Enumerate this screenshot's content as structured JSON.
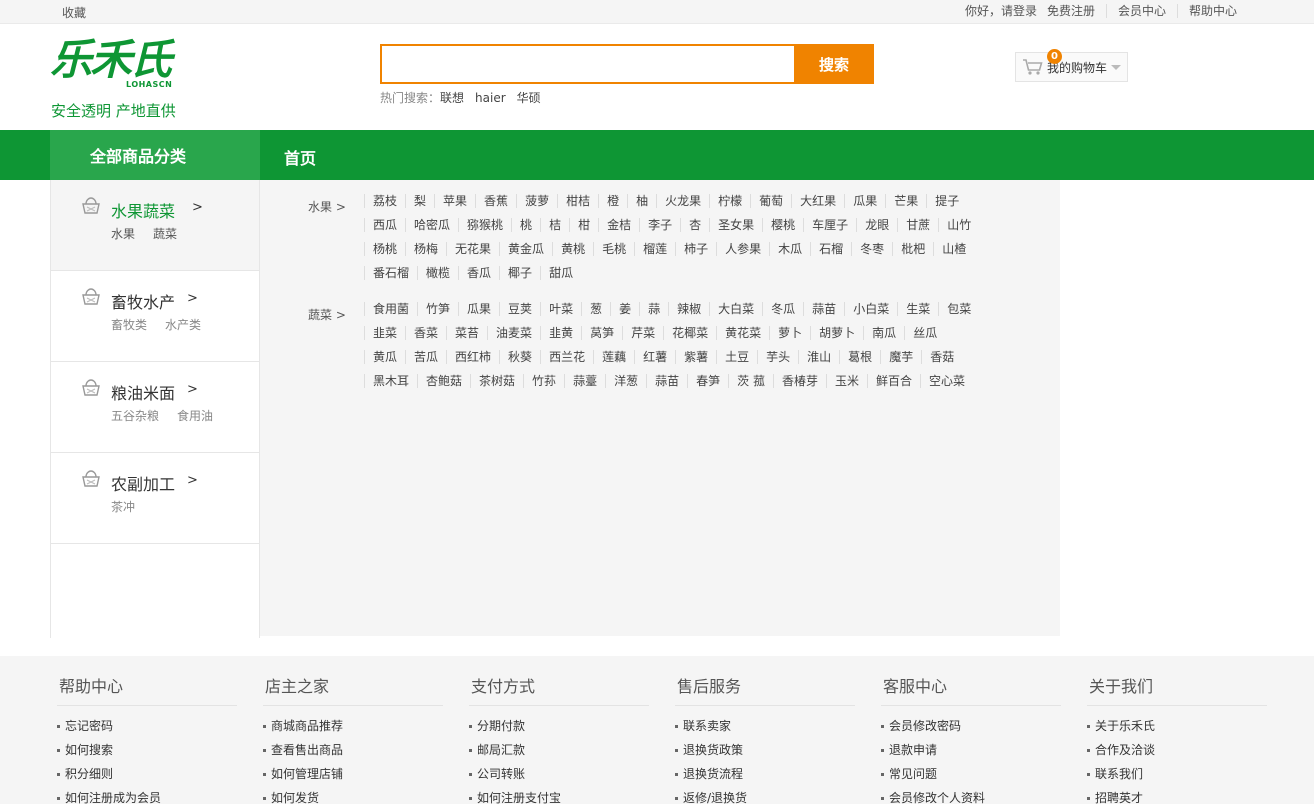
{
  "topbar": {
    "favorite": "收藏",
    "greeting": "你好，请登录",
    "register": "免费注册",
    "member": "会员中心",
    "help": "帮助中心"
  },
  "logo": {
    "mark": "乐禾氏",
    "english": "LOHASCN",
    "slogan": "安全透明  产地直供"
  },
  "search": {
    "placeholder": "",
    "button": "搜索",
    "hot_label": "热门搜索：",
    "hot_terms": [
      "联想",
      "haier",
      "华硕"
    ]
  },
  "cart": {
    "count": "0",
    "label": "我的购物车"
  },
  "nav": {
    "all_categories": "全部商品分类",
    "home": "首页"
  },
  "categories": [
    {
      "title": "水果蔬菜",
      "arrow": ">",
      "subs": [
        "水果",
        "蔬菜"
      ]
    },
    {
      "title": "畜牧水产",
      "arrow": ">",
      "subs": [
        "畜牧类",
        "水产类"
      ]
    },
    {
      "title": "粮油米面",
      "arrow": ">",
      "subs": [
        "五谷杂粮",
        "食用油"
      ]
    },
    {
      "title": "农副加工",
      "arrow": ">",
      "subs": [
        "茶冲"
      ]
    }
  ],
  "panel": {
    "groups": [
      {
        "name": "水果 >",
        "items": [
          "荔枝",
          "梨",
          "苹果",
          "香蕉",
          "菠萝",
          "柑桔",
          "橙",
          "柚",
          "火龙果",
          "柠檬",
          "葡萄",
          "大红果",
          "瓜果",
          "芒果",
          "提子",
          "西瓜",
          "哈密瓜",
          "猕猴桃",
          "桃",
          "桔",
          "柑",
          "金桔",
          "李子",
          "杏",
          "圣女果",
          "樱桃",
          "车厘子",
          "龙眼",
          "甘蔗",
          "山竹",
          "杨桃",
          "杨梅",
          "无花果",
          "黄金瓜",
          "黄桃",
          "毛桃",
          "榴莲",
          "柿子",
          "人参果",
          "木瓜",
          "石榴",
          "冬枣",
          "枇杷",
          "山楂",
          "番石榴",
          "橄榄",
          "香瓜",
          "椰子",
          "甜瓜"
        ]
      },
      {
        "name": "蔬菜 >",
        "items": [
          "食用菌",
          "竹笋",
          "瓜果",
          "豆荚",
          "叶菜",
          "葱",
          "姜",
          "蒜",
          "辣椒",
          "大白菜",
          "冬瓜",
          "蒜苗",
          "小白菜",
          "生菜",
          "包菜",
          "韭菜",
          "香菜",
          "菜苔",
          "油麦菜",
          "韭黄",
          "莴笋",
          "芹菜",
          "花椰菜",
          "黄花菜",
          "萝卜",
          "胡萝卜",
          "南瓜",
          "丝瓜",
          "黄瓜",
          "苦瓜",
          "西红柿",
          "秋葵",
          "西兰花",
          "莲藕",
          "红薯",
          "紫薯",
          "土豆",
          "芋头",
          "淮山",
          "葛根",
          "魔芋",
          "香菇",
          "黑木耳",
          "杏鲍菇",
          "茶树菇",
          "竹荪",
          "蒜薹",
          "洋葱",
          "蒜苗",
          "春笋",
          "茨 菰",
          "香椿芽",
          "玉米",
          "鲜百合",
          "空心菜"
        ]
      }
    ]
  },
  "footer": {
    "columns": [
      {
        "title": "帮助中心",
        "links": [
          "忘记密码",
          "如何搜索",
          "积分细则",
          "如何注册成为会员"
        ]
      },
      {
        "title": "店主之家",
        "links": [
          "商城商品推荐",
          "查看售出商品",
          "如何管理店铺",
          "如何发货"
        ]
      },
      {
        "title": "支付方式",
        "links": [
          "分期付款",
          "邮局汇款",
          "公司转账",
          "如何注册支付宝"
        ]
      },
      {
        "title": "售后服务",
        "links": [
          "联系卖家",
          "退换货政策",
          "退换货流程",
          "返修/退换货"
        ]
      },
      {
        "title": "客服中心",
        "links": [
          "会员修改密码",
          "退款申请",
          "常见问题",
          "会员修改个人资料"
        ]
      },
      {
        "title": "关于我们",
        "links": [
          "关于乐禾氏",
          "合作及洽谈",
          "联系我们",
          "招聘英才"
        ]
      }
    ]
  },
  "colors": {
    "brand_green": "#0e9634",
    "nav_highlight": "#29a64c",
    "accent_orange": "#f08300"
  }
}
